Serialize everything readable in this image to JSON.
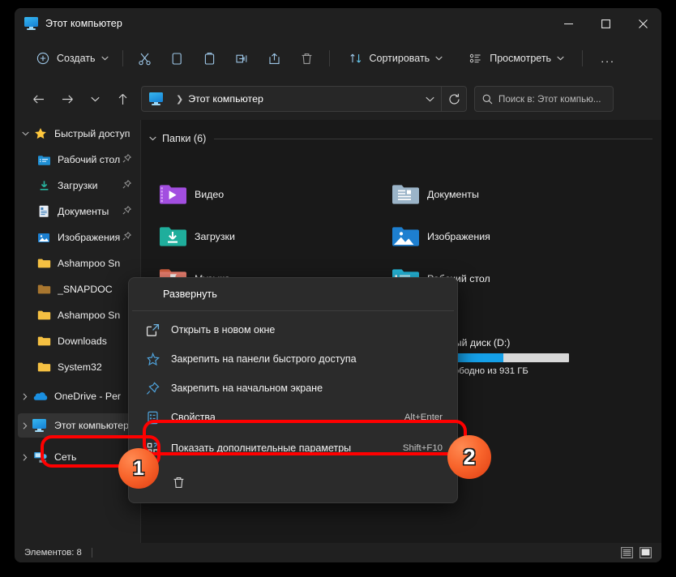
{
  "window": {
    "title": "Этот компьютер",
    "title_icon": "this-pc-icon",
    "controls": {
      "minimize": "minimize-icon",
      "maximize": "maximize-icon",
      "close": "close-icon"
    }
  },
  "toolbar": {
    "new_label": "Создать",
    "cut_label": "Вырезать",
    "copy_label": "Копировать",
    "paste_label": "Вставить",
    "rename_label": "Переименовать",
    "share_label": "Поделиться",
    "delete_label": "Удалить",
    "sort_label": "Сортировать",
    "view_label": "Просмотреть",
    "more_label": "..."
  },
  "addressbar": {
    "back": "back-arrow-icon",
    "forward": "forward-arrow-icon",
    "recent": "chevron-down-icon",
    "up": "up-arrow-icon",
    "crumb": "Этот компьютер",
    "dropdown": "chevron-down-icon",
    "refresh": "refresh-icon",
    "search_placeholder": "Поиск в: Этот компью..."
  },
  "sidebar": {
    "items": [
      {
        "label": "Быстрый доступ",
        "icon": "star-icon",
        "expandable": true,
        "expanded": true,
        "indent": 0,
        "pinned": false
      },
      {
        "label": "Рабочий стол",
        "icon": "desktop-folder-icon",
        "expandable": false,
        "indent": 1,
        "pinned": true
      },
      {
        "label": "Загрузки",
        "icon": "downloads-folder-icon",
        "expandable": false,
        "indent": 1,
        "pinned": true
      },
      {
        "label": "Документы",
        "icon": "documents-folder-icon",
        "expandable": false,
        "indent": 1,
        "pinned": true
      },
      {
        "label": "Изображения",
        "icon": "pictures-folder-icon",
        "expandable": false,
        "indent": 1,
        "pinned": true
      },
      {
        "label": "Ashampoo Sn",
        "icon": "folder-icon",
        "expandable": false,
        "indent": 1,
        "pinned": false
      },
      {
        "label": "_SNAPDOC",
        "icon": "folder-dark-icon",
        "expandable": false,
        "indent": 1,
        "pinned": false
      },
      {
        "label": "Ashampoo Sn",
        "icon": "folder-icon",
        "expandable": false,
        "indent": 1,
        "pinned": false
      },
      {
        "label": "Downloads",
        "icon": "folder-icon",
        "expandable": false,
        "indent": 1,
        "pinned": false
      },
      {
        "label": "System32",
        "icon": "folder-icon",
        "expandable": false,
        "indent": 1,
        "pinned": false
      },
      {
        "label": "OneDrive - Per",
        "icon": "onedrive-icon",
        "expandable": true,
        "indent": 0,
        "pinned": false
      },
      {
        "label": "Этот компьютер",
        "icon": "this-pc-icon",
        "expandable": true,
        "indent": 0,
        "pinned": false,
        "selected": true
      },
      {
        "label": "Сеть",
        "icon": "network-icon",
        "expandable": true,
        "indent": 0,
        "pinned": false
      }
    ]
  },
  "main": {
    "group_header": "Папки (6)",
    "folders": [
      {
        "label": "Видео",
        "icon": "videos-folder-icon"
      },
      {
        "label": "Документы",
        "icon": "documents-folder-icon"
      },
      {
        "label": "Загрузки",
        "icon": "downloads-folder-icon"
      },
      {
        "label": "Изображения",
        "icon": "pictures-folder-icon"
      },
      {
        "label": "Музыка",
        "icon": "music-folder-icon"
      },
      {
        "label": "Рабочий стол",
        "icon": "desktop-folder-icon"
      }
    ],
    "drive": {
      "name": "ный диск (D:)",
      "free_text": "вободно из 931 ГБ",
      "used_percent": 45,
      "bar_color": "#15a0e8"
    }
  },
  "context_menu": {
    "header": "Развернуть",
    "items": [
      {
        "label": "Открыть в новом окне",
        "icon": "open-new-window-icon",
        "accel": ""
      },
      {
        "label": "Закрепить на панели быстрого доступа",
        "icon": "star-outline-icon",
        "accel": ""
      },
      {
        "label": "Закрепить на начальном экране",
        "icon": "pin-icon",
        "accel": ""
      },
      {
        "label": "Свойства",
        "icon": "properties-icon",
        "accel": "Alt+Enter"
      },
      {
        "label": "Показать дополнительные параметры",
        "icon": "more-options-icon",
        "accel": "Shift+F10"
      }
    ],
    "footer_icon": "trash-icon"
  },
  "statusbar": {
    "items_text": "Элементов: 8",
    "view_list_icon": "list-view-icon",
    "view_tiles_icon": "tiles-view-icon"
  },
  "annotations": {
    "highlight_color": "#ff0000",
    "badges": [
      {
        "number": "1",
        "target": "sidebar-item-this-pc"
      },
      {
        "number": "2",
        "target": "menu-item-show-more-options"
      }
    ]
  }
}
